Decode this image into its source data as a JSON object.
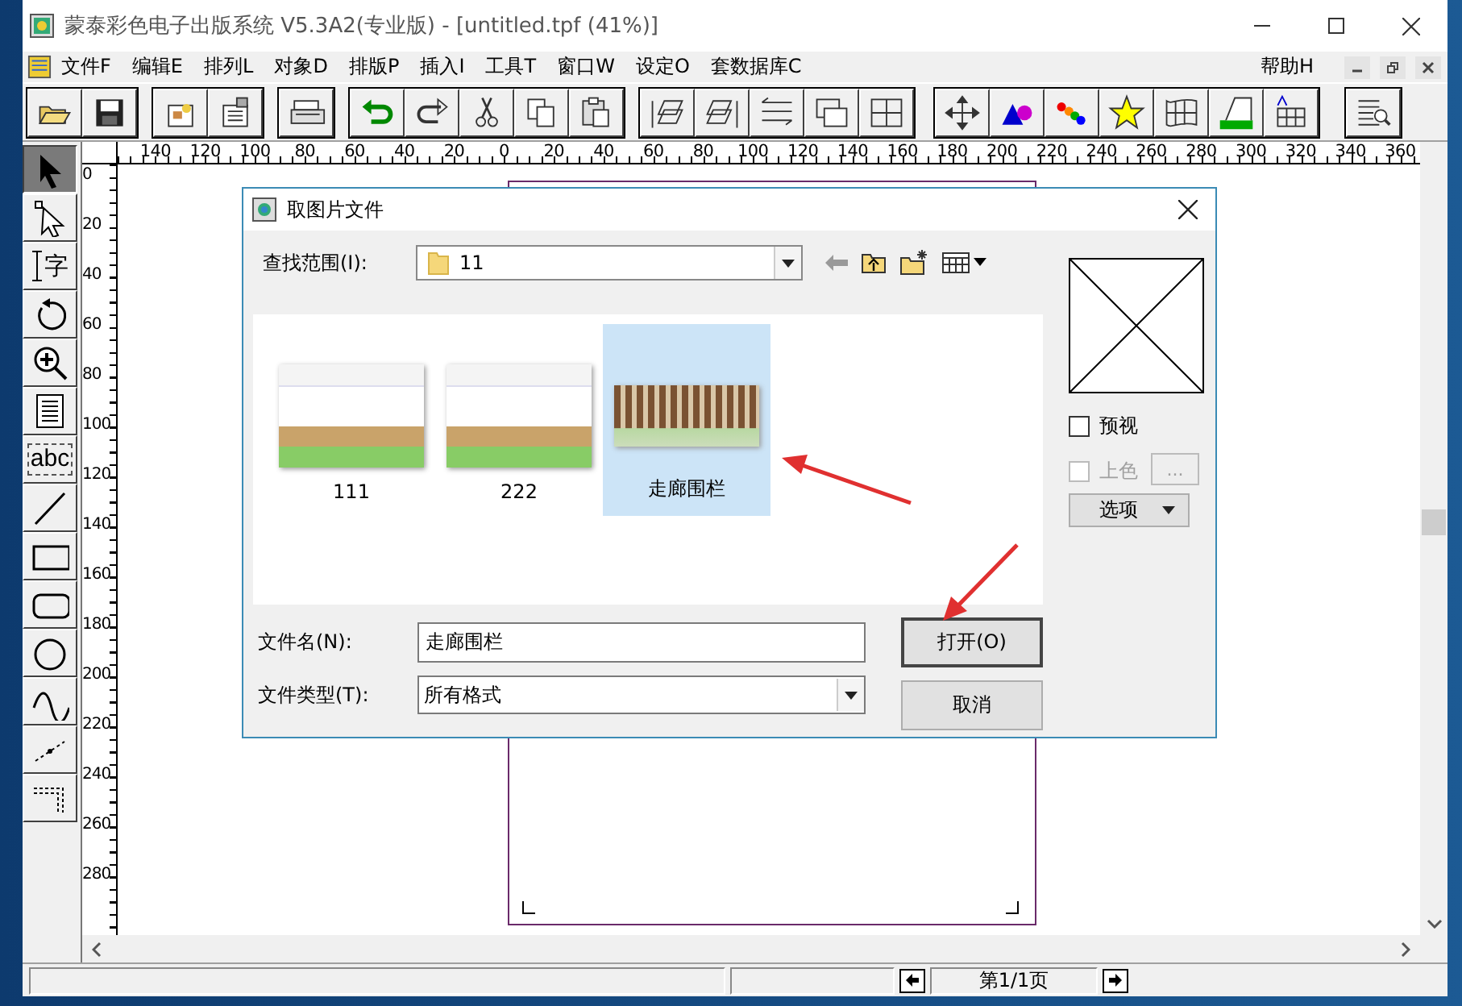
{
  "window": {
    "title": "蒙泰彩色电子出版系统 V5.3A2(专业版) - [untitled.tpf (41%)]"
  },
  "menu": {
    "items": [
      "文件F",
      "编辑E",
      "排列L",
      "对象D",
      "排版P",
      "插入I",
      "工具T",
      "窗口W",
      "设定O",
      "套数据库C"
    ],
    "help": "帮助H"
  },
  "rulers": {
    "horizontal": [
      "140",
      "120",
      "100",
      "80",
      "60",
      "40",
      "20",
      "0",
      "20",
      "40",
      "60",
      "80",
      "100",
      "120",
      "140",
      "160",
      "180",
      "200",
      "220",
      "240",
      "260",
      "280",
      "300",
      "320",
      "340",
      "360"
    ],
    "vertical": [
      "0",
      "20",
      "40",
      "60",
      "80",
      "100",
      "120",
      "140",
      "160",
      "180",
      "200",
      "220",
      "240",
      "260",
      "280"
    ]
  },
  "toolbox": [
    {
      "kind": "pointer",
      "selected": true
    },
    {
      "kind": "node",
      "selected": false
    },
    {
      "kind": "text",
      "selected": false,
      "label": "字"
    },
    {
      "kind": "rotate",
      "selected": false
    },
    {
      "kind": "zoom",
      "selected": false
    },
    {
      "kind": "block",
      "selected": false
    },
    {
      "kind": "frame",
      "selected": false,
      "label": "abc"
    },
    {
      "kind": "line",
      "selected": false
    },
    {
      "kind": "rect",
      "selected": false
    },
    {
      "kind": "roundrect",
      "selected": false
    },
    {
      "kind": "ellipse",
      "selected": false
    },
    {
      "kind": "curve",
      "selected": false
    },
    {
      "kind": "polyline",
      "selected": false
    },
    {
      "kind": "corner",
      "selected": false
    }
  ],
  "dialog": {
    "title": "取图片文件",
    "look_in": {
      "label": "查找范围(I):",
      "value": "11"
    },
    "files": [
      {
        "name": "111",
        "kind": "screenshot",
        "selected": false
      },
      {
        "name": "222",
        "kind": "screenshot",
        "selected": false
      },
      {
        "name": "走廊围栏",
        "kind": "picture",
        "selected": true
      }
    ],
    "preview": {
      "label": "预视",
      "checked": false
    },
    "colorize": {
      "label": "上色",
      "checked": false,
      "disabled": true,
      "button": "..."
    },
    "options_button": "选项",
    "file_name": {
      "label": "文件名(N):",
      "value": "走廊围栏"
    },
    "file_type": {
      "label": "文件类型(T):",
      "value": "所有格式"
    },
    "buttons": [
      "打开(O)",
      "取消"
    ]
  },
  "status_bar": {
    "page": "第1/1页"
  }
}
